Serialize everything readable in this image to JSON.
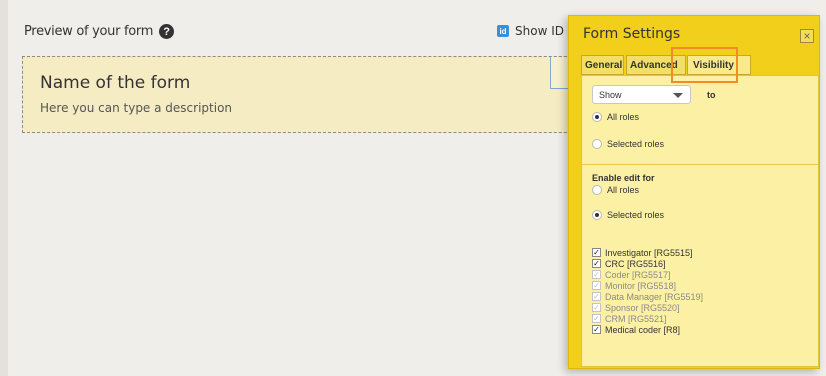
{
  "preview": {
    "title": "Preview of your form",
    "help_glyph": "?",
    "show_id_glyph": "id",
    "show_id_label": "Show ID",
    "form_name": "Name of the form",
    "form_description": "Here you can type a description"
  },
  "panel": {
    "title": "Form Settings",
    "close_glyph": "×",
    "tabs": [
      {
        "label": "General"
      },
      {
        "label": "Advanced"
      },
      {
        "label": "Visibility"
      }
    ],
    "active_tab": "Visibility",
    "visibility": {
      "select_value": "Show",
      "to_label": "to",
      "scope_options": [
        {
          "label": "All roles",
          "selected": true
        },
        {
          "label": "Selected roles",
          "selected": false
        }
      ]
    },
    "enable_edit": {
      "heading": "Enable edit for",
      "options": [
        {
          "label": "All roles",
          "selected": false
        },
        {
          "label": "Selected roles",
          "selected": true
        }
      ],
      "check_glyph": "✓",
      "roles": [
        {
          "label": "Investigator [RG5515]",
          "checked": true,
          "disabled": false
        },
        {
          "label": "CRC [RG5516]",
          "checked": true,
          "disabled": false
        },
        {
          "label": "Coder [RG5517]",
          "checked": true,
          "disabled": true
        },
        {
          "label": "Monitor [RG5518]",
          "checked": true,
          "disabled": true
        },
        {
          "label": "Data Manager [RG5519]",
          "checked": true,
          "disabled": true
        },
        {
          "label": "Sponsor [RG5520]",
          "checked": true,
          "disabled": true
        },
        {
          "label": "CRM [RG5521]",
          "checked": true,
          "disabled": true
        },
        {
          "label": "Medical coder [R8]",
          "checked": true,
          "disabled": false
        }
      ]
    }
  },
  "colors": {
    "panel_bg": "#f2cf1b",
    "content_bg": "#fcf0a4",
    "card_bg": "#f5ecc4",
    "tab_highlight": "#f28c28",
    "id_icon": "#3a8fd6"
  }
}
